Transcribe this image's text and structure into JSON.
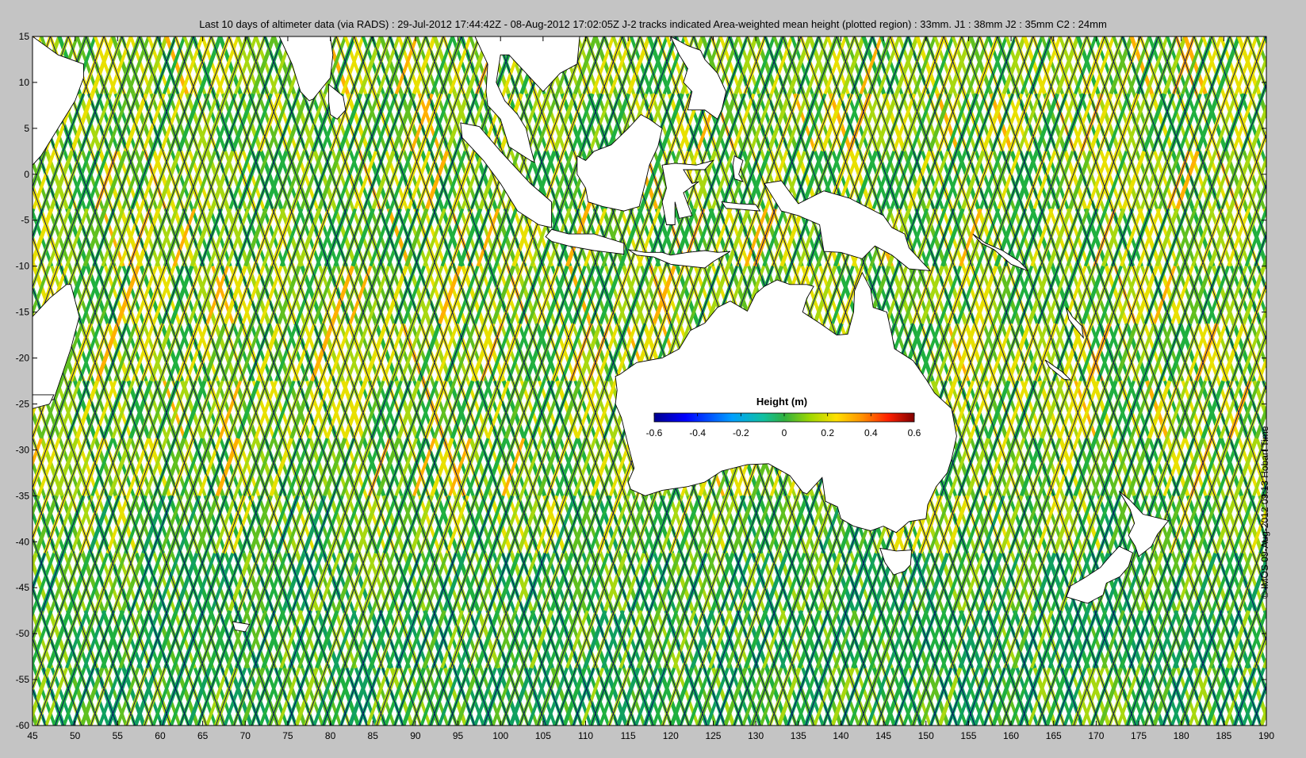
{
  "title": "Last 10 days of altimeter data (via RADS) : 29-Jul-2012 17:44:42Z - 08-Aug-2012 17:02:05Z  J-2 tracks indicated  Area-weighted mean height (plotted region) : 33mm.  J1 : 38mm  J2 : 35mm  C2 : 24mm",
  "credit": "© IMOS 09-Aug-2012 09:13 Hobart Time",
  "map": {
    "lon_range": [
      45,
      190
    ],
    "lat_range": [
      -60,
      15
    ],
    "x_ticks": [
      45,
      50,
      55,
      60,
      65,
      70,
      75,
      80,
      85,
      90,
      95,
      100,
      105,
      110,
      115,
      120,
      125,
      130,
      135,
      140,
      145,
      150,
      155,
      160,
      165,
      170,
      175,
      180,
      185,
      190
    ],
    "x_tick_labels": [
      "45",
      "50",
      "55",
      "60",
      "65",
      "70",
      "75",
      "80",
      "85",
      "90",
      "95",
      "100",
      "105",
      "110",
      "115",
      "120",
      "125",
      "130",
      "135",
      "140",
      "145",
      "150",
      "155",
      "160",
      "165",
      "170",
      "175",
      "180",
      "185",
      "190"
    ],
    "y_ticks": [
      15,
      10,
      5,
      0,
      -5,
      -10,
      -15,
      -20,
      -25,
      -30,
      -35,
      -40,
      -45,
      -50,
      -55,
      -60
    ],
    "y_tick_labels": [
      "15",
      "10",
      "5",
      "0",
      "-5",
      "-10",
      "-15",
      "-20",
      "-25",
      "-30",
      "-35",
      "-40",
      "-45",
      "-50",
      "-55",
      "-60"
    ],
    "land_color": "#ffffff",
    "track_color": "#000066"
  },
  "colorbar": {
    "title": "Height (m)",
    "range": [
      -0.6,
      0.6
    ],
    "ticks": [
      -0.6,
      -0.4,
      -0.2,
      0,
      0.2,
      0.4,
      0.6
    ],
    "tick_labels": [
      "-0.6",
      "-0.4",
      "-0.2",
      "0",
      "0.2",
      "0.4",
      "0.6"
    ],
    "colormap": "jet",
    "colors": [
      "#00008f",
      "#0000ff",
      "#0080ff",
      "#00c8c8",
      "#1cb050",
      "#80d000",
      "#ffe000",
      "#ff8000",
      "#ff0000",
      "#800000"
    ]
  }
}
